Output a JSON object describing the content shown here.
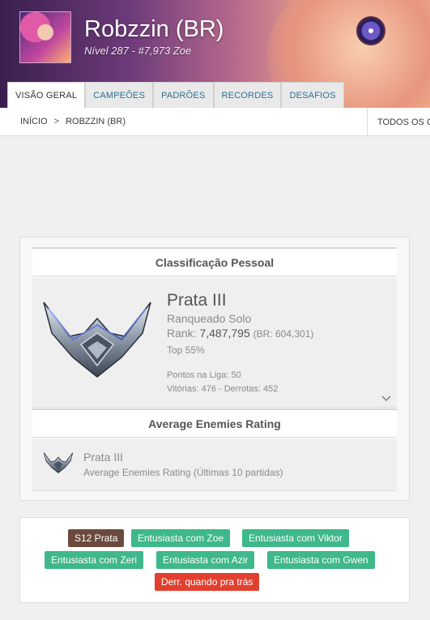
{
  "profile": {
    "name": "Robzzin (BR)",
    "subtitle": "Nível 287 - #7,973 Zoe"
  },
  "tabs": [
    "VISÃO GERAL",
    "CAMPEÕES",
    "PADRÕES",
    "RECORDES",
    "DESAFIOS"
  ],
  "breadcrumb": {
    "home": "INÍCIO",
    "separator": ">",
    "current": "ROBZZIN (BR)",
    "right": "TODOS OS CA"
  },
  "personal_rating": {
    "heading": "Classificação Pessoal",
    "tier": "Prata III",
    "queue": "Ranqueado Solo",
    "rank_label": "Rank:",
    "rank": "7,487,795",
    "rank_region": "(BR: 604,301)",
    "top": "Top 55%",
    "league_points": "Pontos na Liga: 50",
    "wins_losses": "Vitórias: 476 - Derrotas: 452"
  },
  "enemies_rating": {
    "heading": "Average Enemies Rating",
    "tier": "Prata III",
    "subtitle": "Average Enemies Rating (Últimas 10 partidas)"
  },
  "badges": [
    {
      "label": "S12 Prata",
      "color": "#6b4a3d"
    },
    {
      "label": "Entusiasta com Zoe",
      "color": "#3fb88a"
    },
    {
      "label": "Entusiasta com Viktor",
      "color": "#3fb88a"
    },
    {
      "label": "Entusiasta com Zeri",
      "color": "#3fb88a"
    },
    {
      "label": "Entusiasta com Azir",
      "color": "#3fb88a"
    },
    {
      "label": "Entusiasta com Gwen",
      "color": "#3fb88a"
    },
    {
      "label": "Derr. quando pra trás",
      "color": "#e2402f"
    }
  ],
  "icons": {
    "avatar": "zoe-champion-avatar",
    "emblem": "silver-rank-emblem-icon",
    "chevron": "chevron-down-icon"
  }
}
